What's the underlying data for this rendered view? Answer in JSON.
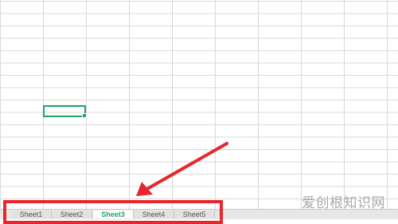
{
  "spreadsheet": {
    "sheet_tabs": [
      {
        "label": "Sheet1"
      },
      {
        "label": "Sheet2"
      },
      {
        "label": "Sheet3"
      },
      {
        "label": "Sheet4"
      },
      {
        "label": "Sheet5"
      }
    ],
    "active_sheet": "Sheet3",
    "add_sheet_label": "+"
  },
  "annotation": {
    "highlight_color": "#e8272d",
    "selection_color": "#21a366"
  },
  "watermark": {
    "text": "爱创根知识网"
  }
}
